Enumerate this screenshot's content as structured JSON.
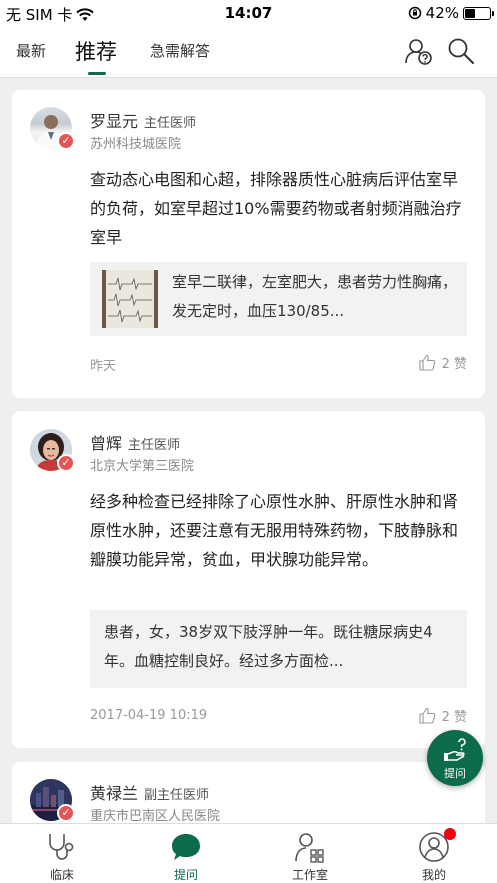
{
  "status_bar": {
    "carrier": "无 SIM 卡",
    "time": "14:07",
    "battery": "42%",
    "battery_level": 0.42
  },
  "nav": {
    "tabs": [
      {
        "label": "最新"
      },
      {
        "label": "推荐"
      },
      {
        "label": "急需解答"
      }
    ],
    "active_tab": "推荐",
    "icons": [
      "ask-expert-icon",
      "search-icon"
    ]
  },
  "cards": [
    {
      "doctor": "罗显元",
      "title": "主任医师",
      "hospital": "苏州科技城医院",
      "answer": "查动态心电图和心超，排除器质性心脏病后评估室早的负荷，如室早超过10%需要药物或者射频消融治疗室早",
      "question": "室早二联律，左室肥大，患者劳力性胸痛，发无定时，血压130/85...",
      "date": "昨天",
      "likes": "2 赞"
    },
    {
      "doctor": "曾辉",
      "title": "主任医师",
      "hospital": "北京大学第三医院",
      "answer": "经多种检查已经排除了心原性水肿、肝原性水肿和肾原性水肿，还要注意有无服用特殊药物，下肢静脉和瓣膜功能异常，贫血，甲状腺功能异常。",
      "question": "患者，女，38岁双下肢浮肿一年。既往糖尿病史4年。血糖控制良好。经过多方面检...",
      "date": "2017-04-19 10:19",
      "likes": "2 赞"
    },
    {
      "doctor": "黄禄兰",
      "title": "副主任医师",
      "hospital": "重庆市巴南区人民医院"
    }
  ],
  "fab": {
    "label": "提问"
  },
  "tabbar": {
    "items": [
      {
        "label": "临床",
        "icon": "stethoscope-icon"
      },
      {
        "label": "提问",
        "icon": "chat-bubble-icon"
      },
      {
        "label": "工作室",
        "icon": "studio-icon"
      },
      {
        "label": "我的",
        "icon": "profile-icon"
      }
    ],
    "active": "提问"
  },
  "colors": {
    "accent": "#0d6b4d",
    "badge": "#e25555",
    "notification_dot": "#ee1111"
  }
}
